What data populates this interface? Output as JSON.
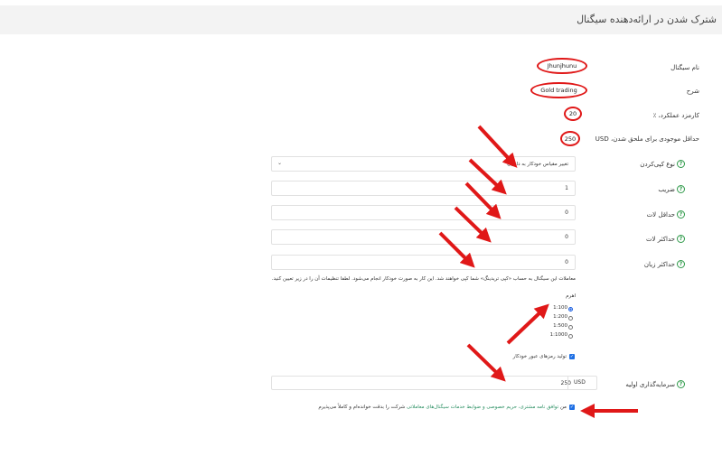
{
  "header": {
    "title": "شترک شدن در ارائه‌دهنده سیگنال"
  },
  "info": {
    "signal_name_label": "نام سیگنال",
    "signal_name_value": "Jhunjhunu",
    "description_label": "شرح",
    "description_value": "Gold trading",
    "commission_label": "کارمزد عملکرد، ٪",
    "commission_value": "20",
    "min_deposit_label": "حداقل موجودی برای ملحق شدن، USD",
    "min_deposit_value": "250"
  },
  "form": {
    "copy_type_label": "نوع کپی‌کردن",
    "copy_type_value": "تغییر مقیاس خودکار به دارایی",
    "multiplier_label": "ضریب",
    "multiplier_value": "1",
    "min_lot_label": "حداقل لات",
    "min_lot_value": "0",
    "max_lot_label": "حداکثر لات",
    "max_lot_value": "0",
    "max_loss_label": "حداکثر زیان",
    "max_loss_value": "0",
    "notice_text": "معاملات این سیگنال به حساب «کپی تریدینگ» شما کپی خواهند شد. این کار به صورت خودکار انجام می‌شود. لطفا تنظیمات آن را در زیر تعیین کنید.",
    "leverage_label": "اهرم",
    "leverage_options": [
      "1:100",
      "1:200",
      "1:500",
      "1:1000"
    ],
    "leverage_selected": "1:100",
    "auto_password_label": "تولید رمزهای عبور خودکار",
    "initial_investment_label": "سرمایه‌گذاری اولیه",
    "initial_investment_value": "250",
    "currency": "USD",
    "terms_prefix": "من ",
    "terms_link": "توافق نامه مشتری، حریم خصوصی و ضوابط خدمات سیگنال‌های معاملاتی",
    "terms_suffix": " شرکت را بدقت خوانده‌ام و کاملاً می‌پذیرم"
  },
  "colors": {
    "annotation": "#e01818",
    "accent": "#2f9a4a",
    "checkbox": "#1e6fe4"
  }
}
